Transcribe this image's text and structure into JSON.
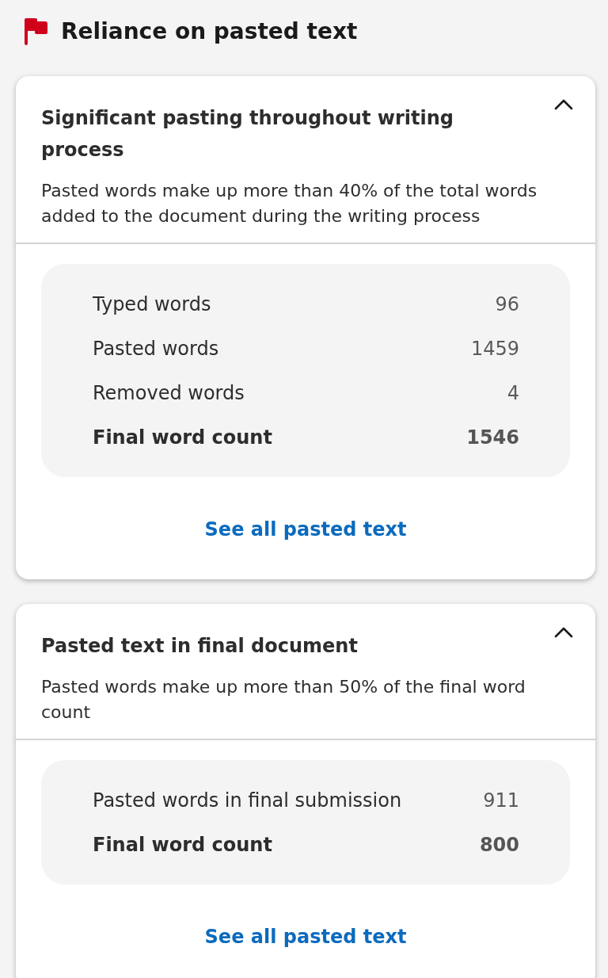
{
  "header": {
    "title": "Reliance on pasted text"
  },
  "cards": [
    {
      "title": "Significant pasting throughout writing process",
      "description": "Pasted words make up more than 40% of the total words added to the document during the writing process",
      "expanded": true,
      "stats": [
        {
          "kind": "item",
          "label": "Typed words",
          "value": "96"
        },
        {
          "kind": "item",
          "label": "Pasted words",
          "value": "1459"
        },
        {
          "kind": "item",
          "label": "Removed words",
          "value": "4"
        },
        {
          "kind": "total",
          "label": "Final word count",
          "value": "1546"
        }
      ],
      "link": "See all pasted text"
    },
    {
      "title": "Pasted text in final document",
      "description": "Pasted words make up more than 50% of the final word count",
      "expanded": true,
      "stats": [
        {
          "kind": "item",
          "label": "Pasted words in final submission",
          "value": "911"
        },
        {
          "kind": "total",
          "label": "Final word count",
          "value": "800"
        }
      ],
      "link": "See all pasted text"
    }
  ]
}
